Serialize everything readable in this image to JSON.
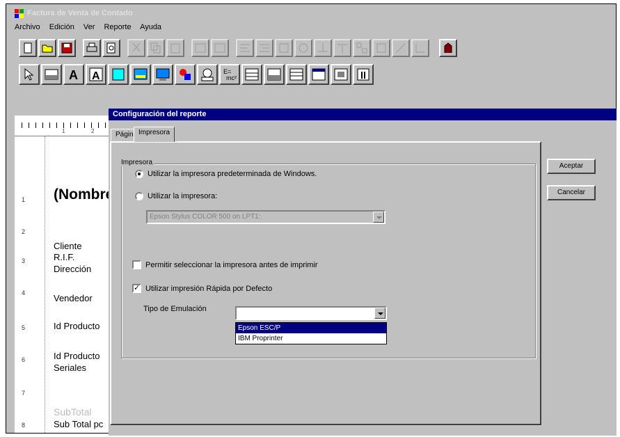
{
  "window": {
    "title": "Factura de Venta de Contado"
  },
  "menu": [
    "Archivo",
    "Edición",
    "Ver",
    "Reporte",
    "Ayuda"
  ],
  "report": {
    "ruler_numbers": [
      "1",
      "2"
    ],
    "row_numbers": [
      "1",
      "2",
      "3",
      "4",
      "5",
      "6",
      "7",
      "8"
    ],
    "texts": {
      "nombre": "(Nombre",
      "cliente": "Cliente",
      "rif": "R.I.F.",
      "direccion": "Dirección",
      "vendedor": "Vendedor",
      "id_producto_1": "Id Producto",
      "id_producto_2": "Id Producto",
      "seriales": "Seriales",
      "subtotal_ghost": "SubTotal",
      "sub_total_pc": "Sub Total pc"
    }
  },
  "dialog": {
    "title": "Configuración del reporte",
    "tabs": [
      "Página",
      "Impresora"
    ],
    "active_tab": "Impresora",
    "group_label": "Impresora",
    "radio_default": "Utilizar la impresora predeterminada de Windows.",
    "radio_specific": "Utilizar la impresora:",
    "printer_value": "Epson Stylus COLOR 500 on LPT1:",
    "check_select": "Permitir seleccionar la impresora antes de imprimir",
    "check_fast": "Utilizar impresión Rápida por Defecto",
    "emulation_label": "Tipo de Emulación",
    "emulation_value": "",
    "emulation_options": [
      "Epson ESC/P",
      "IBM Proprinter"
    ],
    "accept_button": "Aceptar",
    "cancel_button": "Cancelar"
  }
}
